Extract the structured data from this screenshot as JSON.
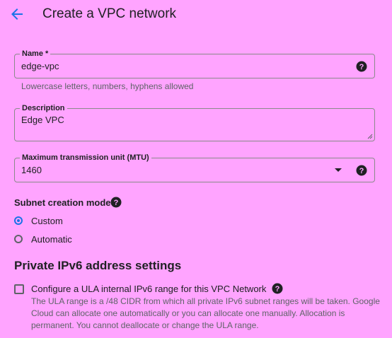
{
  "header": {
    "back_icon": "arrow-back-icon",
    "title": "Create a VPC network"
  },
  "form": {
    "name": {
      "label": "Name *",
      "value": "edge-vpc",
      "hint": "Lowercase letters, numbers, hyphens allowed"
    },
    "description": {
      "label": "Description",
      "value": "Edge VPC"
    },
    "mtu": {
      "label": "Maximum transmission unit (MTU)",
      "value": "1460"
    },
    "subnet_mode": {
      "label": "Subnet creation mode",
      "options": [
        {
          "label": "Custom",
          "selected": true
        },
        {
          "label": "Automatic",
          "selected": false
        }
      ]
    }
  },
  "ipv6": {
    "heading": "Private IPv6 address settings",
    "checkbox_label": "Configure a ULA internal IPv6 range for this VPC Network",
    "checked": false,
    "description": "The ULA range is a /48 CIDR from which all private IPv6 subnet ranges will be taken. Google Cloud can allocate one automatically or you can allocate one manually. Allocation is permanent. You cannot deallocate or change the ULA range."
  },
  "colors": {
    "background": "#ffa4ff",
    "accent": "#1a73e8",
    "text": "#202124",
    "secondary_text": "#5f6368"
  }
}
